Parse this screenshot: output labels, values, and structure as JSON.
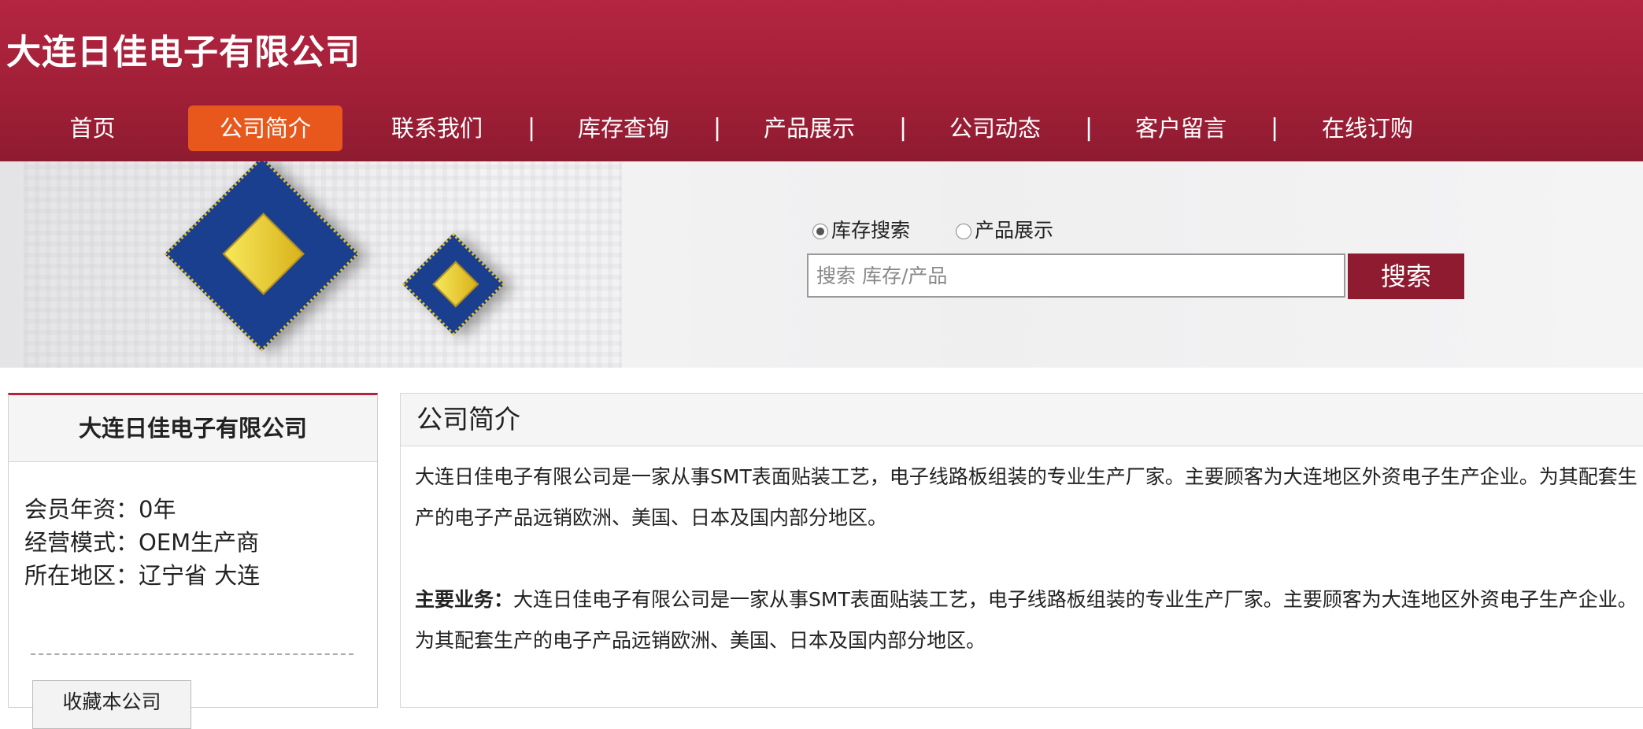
{
  "header": {
    "logo_text": "大连日佳电子有限公司",
    "nav": [
      {
        "label": "首页"
      },
      {
        "label": "公司简介",
        "active": true
      },
      {
        "label": "联系我们"
      },
      {
        "label": "库存查询"
      },
      {
        "label": "产品展示"
      },
      {
        "label": "公司动态"
      },
      {
        "label": "客户留言"
      },
      {
        "label": "在线订购"
      }
    ],
    "separator": "|",
    "accent_color": "#e8581c",
    "brand_color": "#a01f37"
  },
  "search": {
    "options": [
      {
        "label": "库存搜索",
        "checked": true
      },
      {
        "label": "产品展示",
        "checked": false
      }
    ],
    "placeholder": "搜索 库存/产品",
    "button_label": "搜索"
  },
  "sidebar": {
    "company_name": "大连日佳电子有限公司",
    "info": [
      {
        "label": "会员年资：",
        "value": "0年"
      },
      {
        "label": "经营模式：",
        "value": "OEM生产商"
      },
      {
        "label": "所在地区：",
        "value": "辽宁省 大连"
      }
    ],
    "favorite_button": "收藏本公司"
  },
  "main": {
    "title": "公司简介",
    "intro": "大连日佳电子有限公司是一家从事SMT表面贴装工艺，电子线路板组装的专业生产厂家。主要顾客为大连地区外资电子生产企业。为其配套生产的电子产品远销欧洲、美国、日本及国内部分地区。",
    "business_label": "主要业务：",
    "business_text": "大连日佳电子有限公司是一家从事SMT表面贴装工艺，电子线路板组装的专业生产厂家。主要顾客为大连地区外资电子生产企业。为其配套生产的电子产品远销欧洲、美国、日本及国内部分地区。"
  }
}
